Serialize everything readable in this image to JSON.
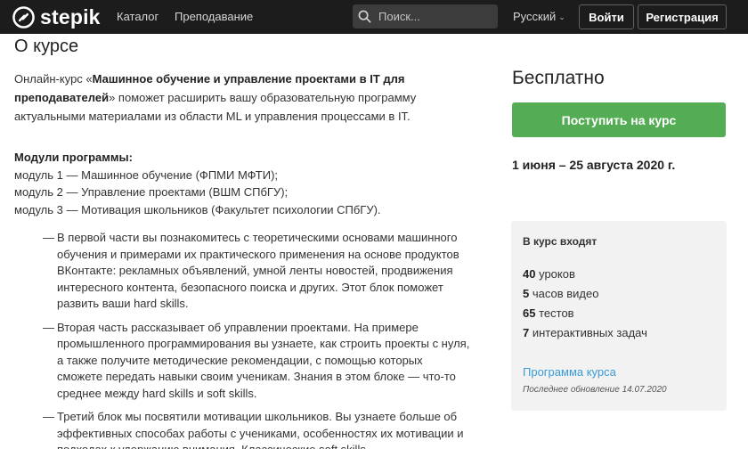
{
  "header": {
    "logo_text": "stepik",
    "nav": [
      "Каталог",
      "Преподавание"
    ],
    "search_placeholder": "Поиск...",
    "language": "Русский",
    "login_label": "Войти",
    "register_label": "Регистрация"
  },
  "main": {
    "title": "О курсе",
    "intro": {
      "prefix": "Онлайн-курс «",
      "course_name": "Машинное обучение и управление проектами в IT для преподавателей",
      "suffix": "» поможет расширить вашу образовательную программу актуальными материалами из области ML и управления процессами в IT."
    },
    "modules_heading": "Модули программы:",
    "modules": [
      "модуль 1 — Машинное обучение (ФПМИ МФТИ);",
      "модуль 2 — Управление проектами (ВШМ СПбГУ);",
      "модуль 3 — Мотивация школьников (Факультет психологии СПбГУ)."
    ],
    "parts": [
      "В первой части вы познакомитесь с теоретическими основами машинного обучения и примерами их практического применения на основе продуктов ВКонтакте: рекламных объявлений, умной ленты новостей, продвижения интересного контента, безопасного поиска и других. Этот блок поможет развить ваши hard skills.",
      "Вторая часть рассказывает об управлении проектами. На примере промышленного программирования вы узнаете, как строить проекты с нуля, а также получите методические рекомендации, с помощью которых сможете передать навыки своим ученикам. Знания в этом блоке — что-то среднее между hard skills и soft skills.",
      "Третий блок мы посвятили мотивации школьников. Вы узнаете больше об эффективных способах работы с учениками, особенностях их мотивации и подходах к удержанию внимания. Классические soft skills."
    ],
    "dash": "—"
  },
  "sidebar": {
    "price": "Бесплатно",
    "enroll_label": "Поступить на курс",
    "dates": "1 июня – 25 августа 2020 г.",
    "includes_title": "В курс входят",
    "includes": [
      {
        "count": "40",
        "label": "уроков"
      },
      {
        "count": "5",
        "label": "часов видео"
      },
      {
        "count": "65",
        "label": "тестов"
      },
      {
        "count": "7",
        "label": "интерактивных задач"
      }
    ],
    "program_link": "Программа курса",
    "last_updated": "Последнее обновление 14.07.2020"
  },
  "colors": {
    "header_bg": "#1c1c1c",
    "accent_green": "#54ad54",
    "link_blue": "#3a9bd6",
    "panel_bg": "#f2f2f2"
  }
}
